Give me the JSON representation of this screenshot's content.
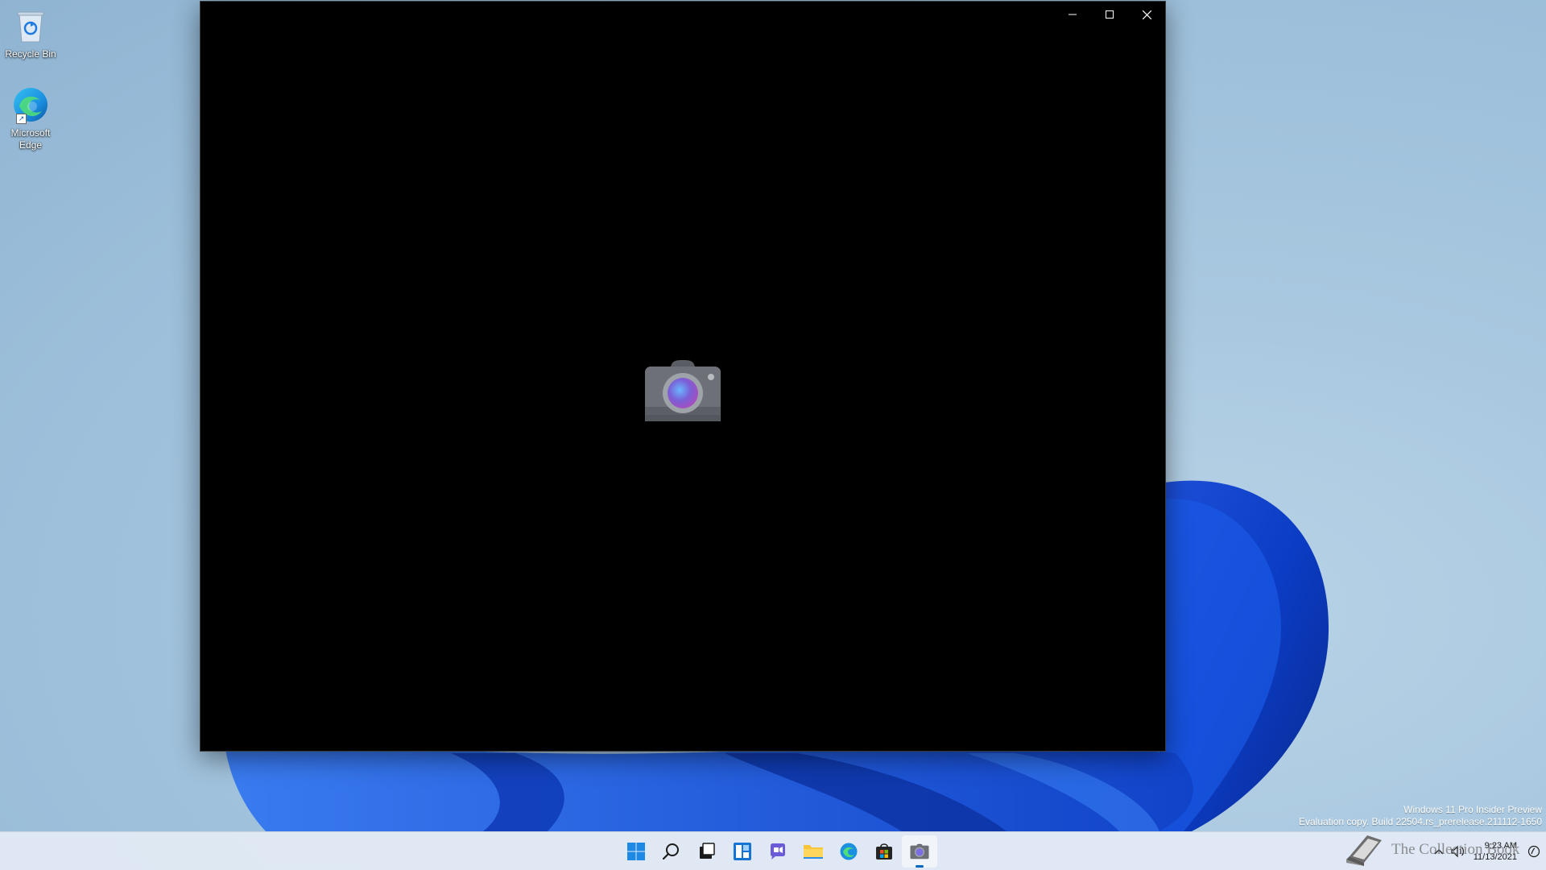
{
  "desktop": {
    "icons": [
      {
        "label": "Recycle Bin",
        "icon": "recycle-bin-icon"
      },
      {
        "label": "Microsoft Edge",
        "icon": "edge-icon"
      }
    ]
  },
  "window": {
    "app": "Camera",
    "controls": {
      "minimize": "minimize-icon",
      "maximize": "maximize-icon",
      "close": "close-icon"
    },
    "center_icon": "camera-icon"
  },
  "watermark": {
    "line1": "Windows 11 Pro Insider Preview",
    "line2": "Evaluation copy. Build 22504.rs_prerelease.211112-1650"
  },
  "taskbar": {
    "apps": [
      {
        "name": "start",
        "icon": "windows-logo-icon"
      },
      {
        "name": "search",
        "icon": "search-icon"
      },
      {
        "name": "task-view",
        "icon": "task-view-icon"
      },
      {
        "name": "widgets",
        "icon": "widgets-icon"
      },
      {
        "name": "chat",
        "icon": "chat-icon"
      },
      {
        "name": "file-explorer",
        "icon": "folder-icon"
      },
      {
        "name": "edge",
        "icon": "edge-icon"
      },
      {
        "name": "store",
        "icon": "store-icon"
      },
      {
        "name": "camera",
        "icon": "camera-icon",
        "active": true
      }
    ],
    "tray": {
      "time": "9:23 AM",
      "date": "11/13/2021"
    }
  },
  "overlay": {
    "brand_text": "The Collection Book",
    "icon": "book-icon"
  },
  "colors": {
    "accent": "#0067c0",
    "window_bg": "#000000",
    "taskbar_bg": "#e2eaf4"
  }
}
